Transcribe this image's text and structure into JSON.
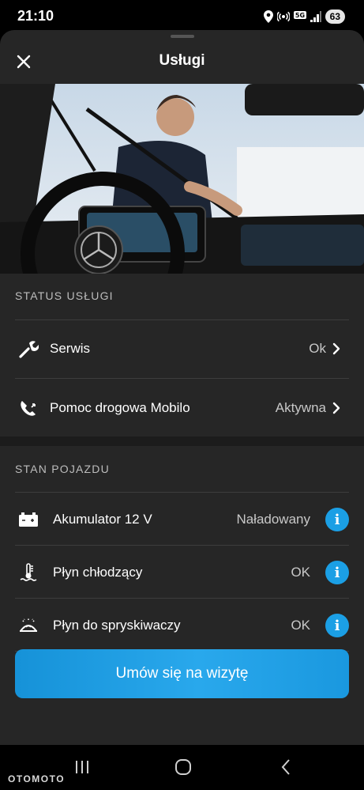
{
  "status_bar": {
    "time": "21:10",
    "battery": "63"
  },
  "header": {
    "title": "Usługi",
    "close_icon": "close-icon"
  },
  "hero": {
    "image": "technician-installing-wiper-blade"
  },
  "service_status": {
    "section_title": "STATUS USŁUGI",
    "items": [
      {
        "icon": "wrench-icon",
        "label": "Serwis",
        "value": "Ok"
      },
      {
        "icon": "roadside-assistance-icon",
        "label": "Pomoc drogowa Mobilo",
        "value": "Aktywna"
      }
    ]
  },
  "vehicle_state": {
    "section_title": "STAN POJAZDU",
    "items": [
      {
        "icon": "battery-icon",
        "label": "Akumulator 12 V",
        "value": "Naładowany"
      },
      {
        "icon": "coolant-icon",
        "label": "Płyn chłodzący",
        "value": "OK"
      },
      {
        "icon": "washer-fluid-icon",
        "label": "Płyn do spryskiwaczy",
        "value": "OK"
      }
    ]
  },
  "cta": {
    "label": "Umów się na wizytę"
  },
  "watermark": "OTOMOTO",
  "colors": {
    "accent": "#1b9fe5",
    "sheet_bg": "#262626",
    "text_secondary": "#c8c8c8"
  }
}
